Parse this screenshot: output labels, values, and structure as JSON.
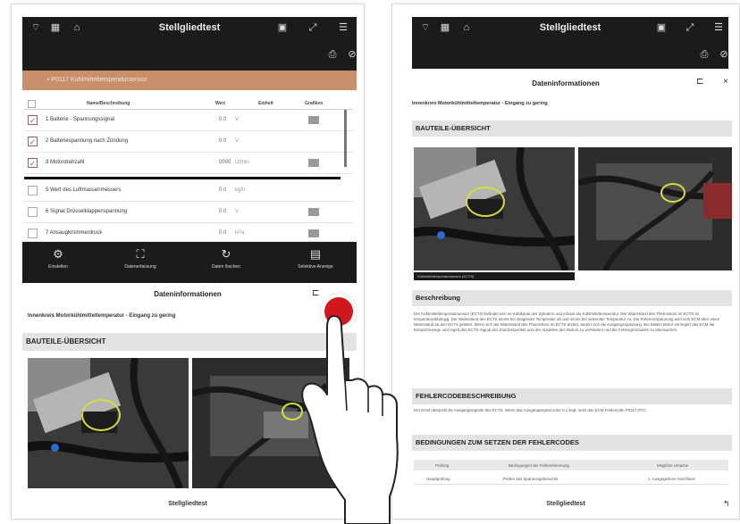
{
  "left_screen": {
    "topbar": {
      "title": "Stellgliedtest",
      "icons": [
        "wifi-icon",
        "signal-icon",
        "vehicle-icon",
        "bluetooth-icon",
        "expand-icon",
        "menu-icon"
      ],
      "subicons": [
        "print-icon",
        "help-icon"
      ]
    },
    "orange_bar_text": "• P0117 Kühlmitteltemperatursensor",
    "table": {
      "headers": [
        "Name/Beschreibung",
        "Wert",
        "Einheit",
        "Grafiken"
      ],
      "rows": [
        {
          "label": "1 Batterie - Spannungssignal",
          "value": "0.0",
          "unit": "V",
          "checked": true,
          "graph": true
        },
        {
          "label": "2 Batteriespannung nach Zündung",
          "value": "0.0",
          "unit": "V",
          "checked": true,
          "graph": false
        },
        {
          "label": "3 Motordrehzahl",
          "value": "0000",
          "unit": "U/min",
          "checked": true,
          "graph": true
        },
        {
          "label": "5 Wert des Luftmassenmessers",
          "value": "0.0",
          "unit": "kg/h",
          "checked": false,
          "graph": false
        },
        {
          "label": "6 Signal Drosselklappenspannung",
          "value": "0.0",
          "unit": "V",
          "checked": false,
          "graph": true
        },
        {
          "label": "7 Ansaugkrümmerdruck",
          "value": "0.0",
          "unit": "kPa",
          "checked": false,
          "graph": true
        }
      ]
    },
    "bottom_bar": [
      {
        "label": "Einstellen",
        "icon": "settings-icon"
      },
      {
        "label": "Datenerfassung",
        "icon": "record-icon"
      },
      {
        "label": "Daten löschen",
        "icon": "refresh-icon"
      },
      {
        "label": "Selektive Anzeige",
        "icon": "list-icon"
      }
    ],
    "sheet": {
      "title": "Dateninformationen",
      "description": "Innenkreis Motorkühlmitteltemperatur - Eingang zu gering",
      "section": "BAUTEILE-ÜBERSICHT"
    },
    "footer_title": "Stellgliedtest"
  },
  "right_screen": {
    "topbar": {
      "title": "Stellgliedtest",
      "icons": [
        "wifi-icon",
        "signal-icon",
        "vehicle-icon",
        "bluetooth-icon",
        "expand-icon",
        "menu-icon"
      ],
      "subicons": [
        "print-icon",
        "help-icon"
      ]
    },
    "sheet": {
      "title": "Dateninformationen",
      "description": "Innenkreis Motorkühlmitteltemperatur - Eingang zu gering",
      "section_components": "BAUTEILE-ÜBERSICHT",
      "photo_caption": "Kühlmitteltemperatursensor (ECTS)",
      "section_description": "Beschreibung",
      "description_text": "Der Kühlmitteltemperatursensor (ECTS) befindet sich im Kühlkanal des Zylinders und erfasst die Kühlmitteltemperatur. Der Widerstand des Thermistors im ECTS ist temperaturabhängig. Der Widerstand des ECTS nimmt bei steigender Temperatur ab und nimmt bei sinkender Temperatur zu. Die Referenzspannung wird vom ECM über einen Widerstand an den ECTS geleitet. Wenn sich der Widerstand des Thermistors im ECTS ändert, ändert sich die Ausgangsspannung. Bei kaltem Motor verringert das ECM die Einspritzmenge und regelt den ECTS-Signal des Zündzeitpunkts und des Abstellen des Motors zu verhindern und die Fehlergrenzwerte zu überwachen.",
      "section_fault": "FEHLERCODEBESCHREIBUNG",
      "fault_text": "Der ECM überprüft die Ausgangssignale des ECTS. Wenn das Ausgangssignal unter 0.1 liegt, setzt das ECM Fehlercode P0117 DTC.",
      "section_conditions": "BEDINGUNGEN ZUM SETZEN DER FEHLERCODES",
      "conditions_headers": [
        "Prüfung",
        "Bedingungen der Fehlererkennung",
        "Mögliche Ursache"
      ],
      "conditions_row": [
        "Hauptprüfung",
        "Prüfen des Spannungsbereichs",
        "1. Ausgegebene Anschluss"
      ]
    },
    "footer_title": "Stellgliedtest"
  },
  "colors": {
    "topbar": "#1b1b1b",
    "orange_bar": "#c98f6b",
    "section_bg": "#e3e3e3",
    "touch_dot": "#d3171f",
    "check": "#b4574e",
    "highlight_ring": "#d7dd3a",
    "marker": "#2f6ad0"
  }
}
